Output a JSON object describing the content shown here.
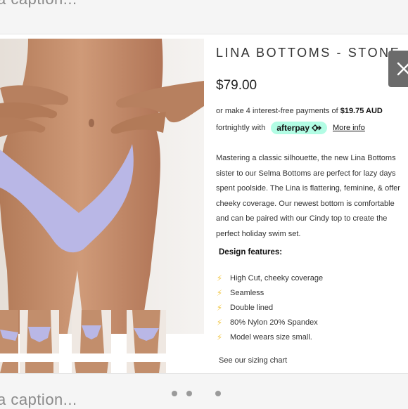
{
  "captions": {
    "top": "a caption...",
    "bottom": "a caption..."
  },
  "product": {
    "title": "LINA BOTTOMS - STONE",
    "price": "$79.00",
    "installment_prefix": "or make 4 interest-free payments of",
    "installment_amount": "$19.75 AUD",
    "fortnightly": "fortnightly with",
    "afterpay_label": "afterpay",
    "more_info": "More info",
    "description": "Mastering a classic silhouette, the new Lina Bottoms sister to our Selma Bottoms are perfect for lazy days spent poolside.  The Lina is flattering, feminine, & offer cheeky coverage. Our newest bottom is comfortable and can be paired with our Cindy top to create the perfect holiday swim set.",
    "design_heading": "Design features:",
    "features": [
      "High Cut, cheeky coverage",
      "Seamless",
      "Double lined",
      "80% Nylon 20% Spandex",
      "Model wears size small."
    ],
    "sizing_prefix": "See our",
    "sizing_link": "sizing chart"
  },
  "icons": {
    "close": "close-icon",
    "feature_bullet": "lightning-icon",
    "afterpay": "afterpay-arrows-icon"
  },
  "colors": {
    "afterpay_badge": "#b2fce4",
    "bolt": "#f2c94c",
    "swimwear": "#b9b7e6"
  },
  "carousel": {
    "dot_count": 3
  }
}
